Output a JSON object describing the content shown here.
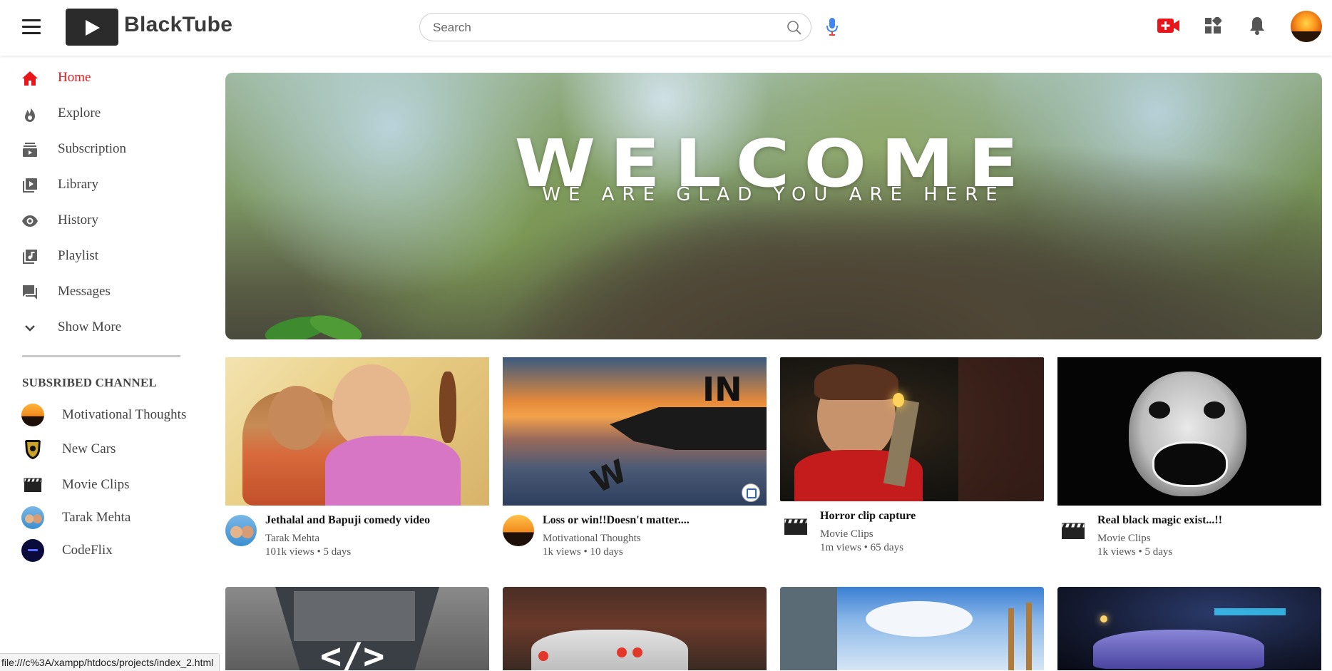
{
  "header": {
    "app_name": "BlackTube",
    "search_placeholder": "Search",
    "icons": [
      "menu-icon",
      "play-icon",
      "search-icon",
      "mic-icon",
      "create-video-icon",
      "apps-icon",
      "notification-bell-icon",
      "user-avatar"
    ]
  },
  "colors": {
    "accent": "#e8161b",
    "text": "#444444",
    "logo_bg": "#2b2b2b",
    "mic": "#4285f4"
  },
  "sidebar": {
    "items": [
      {
        "label": "Home",
        "icon": "home-icon",
        "active": true
      },
      {
        "label": "Explore",
        "icon": "explore-flame-icon"
      },
      {
        "label": "Subscription",
        "icon": "subscription-icon"
      },
      {
        "label": "Library",
        "icon": "library-icon"
      },
      {
        "label": "History",
        "icon": "history-eye-icon"
      },
      {
        "label": "Playlist",
        "icon": "playlist-icon"
      },
      {
        "label": "Messages",
        "icon": "messages-icon"
      },
      {
        "label": "Show More",
        "icon": "chevron-down-icon"
      }
    ],
    "subscribed_heading": "SUBSRIBED CHANNEL",
    "channels": [
      {
        "name": "Motivational Thoughts"
      },
      {
        "name": "New Cars"
      },
      {
        "name": "Movie Clips"
      },
      {
        "name": "Tarak Mehta"
      },
      {
        "name": "CodeFlix"
      }
    ]
  },
  "banner": {
    "title": "WELCOME",
    "subtitle": "WE ARE GLAD YOU ARE HERE"
  },
  "videos": [
    {
      "title": "Jethalal and Bapuji comedy video",
      "channel": "Tarak Mehta",
      "stats": "101k views • 5 days"
    },
    {
      "title": "Loss or win!!Doesn't matter....",
      "channel": "Motivational Thoughts",
      "stats": "1k views • 10 days"
    },
    {
      "title": "Horror clip capture",
      "channel": "Movie Clips",
      "stats": "1m views • 65 days"
    },
    {
      "title": "Real black magic exist...!!",
      "channel": "Movie Clips",
      "stats": "1k views • 5 days"
    }
  ],
  "thumbnail_texts": {
    "win_text": "IN",
    "win_text_2": "W",
    "code_text": "</>"
  },
  "status_bar": "file:///c%3A/xampp/htdocs/projects/index_2.html"
}
